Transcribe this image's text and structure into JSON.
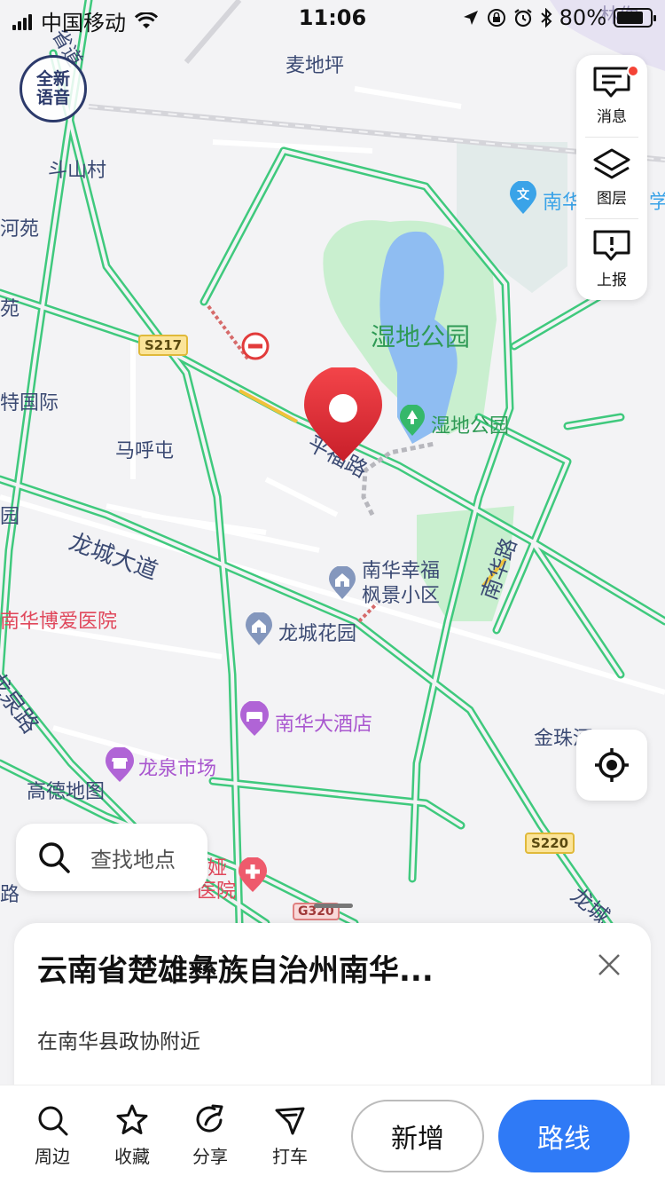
{
  "status_bar": {
    "carrier": "中国移动",
    "time": "11:06",
    "battery_percent": "80%",
    "battery_level": 0.8,
    "icons": [
      "signal-icon",
      "wifi-icon",
      "location-arrow-icon",
      "rotation-lock-icon",
      "alarm-icon",
      "bluetooth-icon",
      "battery-icon"
    ]
  },
  "badge": {
    "line1": "全新",
    "line2": "语音"
  },
  "side_tools": {
    "messages_label": "消息",
    "layers_label": "图层",
    "report_label": "上报",
    "has_unread": true
  },
  "map": {
    "labels": {
      "maidiping": "麦地坪",
      "doushancun": "斗山村",
      "heyuan": "河苑",
      "yuan": "苑",
      "teguoji": "特国际",
      "mahutun": "马呼屯",
      "yuan2": "园",
      "longcheng_dadao": "龙城大道",
      "nanhua_boai": "南华博爱医院",
      "longquan_lu": "龙泉路",
      "gaode_ditu": "高德地图",
      "shidi_gongyuan_area": "湿地公园",
      "shidi_gongyuan_poi": "湿地公园",
      "nanhua_xingfu_1": "南华幸福",
      "nanhua_xingfu_2": "枫景小区",
      "longcheng_huayuan": "龙城花园",
      "nanhua_dajiudian": "南华大酒店",
      "longquan_shichang": "龙泉市场",
      "jinzhu": "金珠河",
      "nanhua_school": "南华",
      "school_suffix": "学",
      "hospital_partial_1": "娅",
      "hospital_partial_2": "医院",
      "road_pinghu": "平福路",
      "road_nanhua": "南华路",
      "longcheng_right": "龙城",
      "shengdao": "省道",
      "lin": "林你",
      "lu_left": "路"
    },
    "shields": {
      "s217": "S217",
      "s220": "S220",
      "g320": "G320"
    },
    "colors": {
      "background": "#f3f3f5",
      "road_traffic": "#3fc97d",
      "park": "#c9efcf",
      "water": "#8fbdf2",
      "label": "#3b4a73",
      "marker": "#e8363a"
    }
  },
  "search": {
    "placeholder": "查找地点"
  },
  "sheet": {
    "title": "云南省楚雄彝族自治州南华...",
    "subtitle": "在南华县政协附近"
  },
  "bottom_bar": {
    "nearby": "周边",
    "favorite": "收藏",
    "share": "分享",
    "taxi": "打车",
    "add": "新增",
    "route": "路线"
  }
}
